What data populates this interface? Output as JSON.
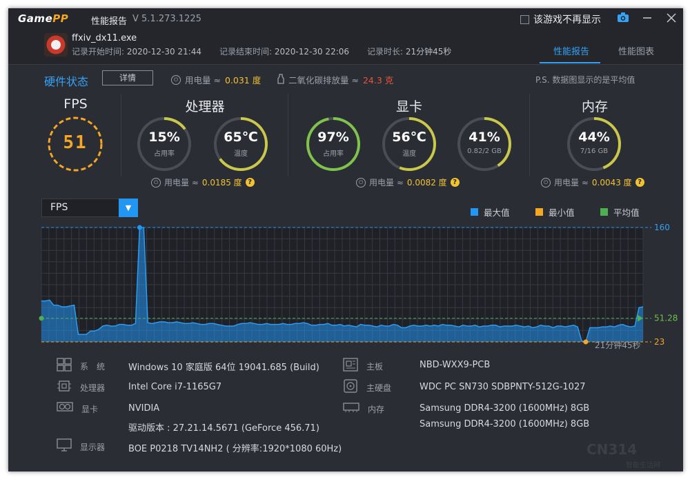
{
  "window": {
    "logo_game": "Game",
    "logo_pp": "PP",
    "title": "性能报告",
    "version": "V 5.1.273.1225",
    "no_show_label": "该游戏不再显示"
  },
  "icons": {
    "camera": "camera-icon",
    "minimize": "minimize-icon",
    "close": "close-icon",
    "power": "power-icon",
    "co2": "co2-icon",
    "question": "question-icon",
    "dropdown": "chevron-down-icon"
  },
  "game": {
    "exe": "ffxiv_dx11.exe",
    "start_label": "记录开始时间:",
    "start": "2020-12-30 21:44",
    "end_label": "记录结束时间:",
    "end": "2020-12-30 22:06",
    "duration_label": "记录时长:",
    "duration": "21分钟45秒"
  },
  "tabs": [
    {
      "label": "性能报告",
      "active": true
    },
    {
      "label": "性能图表",
      "active": false
    }
  ],
  "hardware": {
    "title": "硬件状态",
    "detail_button": "详情",
    "power_label": "用电量 ≈",
    "power_value": "0.031 度",
    "co2_label": "二氧化碳排放量 ≈",
    "co2_value": "24.3 克",
    "note": "P.S. 数据图显示的是平均值"
  },
  "fps": {
    "title": "FPS",
    "value": "51"
  },
  "cpu": {
    "title": "处理器",
    "usage": {
      "value": "15%",
      "label": "占用率",
      "level": 0.15
    },
    "temp": {
      "value": "65℃",
      "label": "温度",
      "level": 0.65
    },
    "power_label": "用电量 ≈",
    "power_value": "0.0185 度",
    "help": "?"
  },
  "gpu": {
    "title": "显卡",
    "usage": {
      "value": "97%",
      "label": "占用率",
      "level": 0.97
    },
    "temp": {
      "value": "56℃",
      "label": "温度",
      "level": 0.56
    },
    "mem": {
      "value": "41%",
      "label": "0.82/2 GB",
      "level": 0.41
    },
    "power_label": "用电量 ≈",
    "power_value": "0.0082 度",
    "help": "?"
  },
  "ram": {
    "title": "内存",
    "usage": {
      "value": "44%",
      "label": "7/16 GB",
      "level": 0.44
    },
    "power_label": "用电量 ≈",
    "power_value": "0.0043 度",
    "help": "?"
  },
  "selector": {
    "value": "FPS"
  },
  "legend": [
    {
      "label": "最大值",
      "color": "#2196f3"
    },
    {
      "label": "最小值",
      "color": "#f5a623"
    },
    {
      "label": "平均值",
      "color": "#4caf50"
    }
  ],
  "chart_data": {
    "type": "area",
    "title": "",
    "xlabel": "",
    "ylabel": "",
    "ylim": [
      23,
      160
    ],
    "max": 160,
    "min": 23,
    "avg": 51.28,
    "labels": {
      "max": "160",
      "avg": "51.28",
      "min": "23"
    },
    "x_end_label": "21分钟45秒",
    "series": [
      {
        "values": [
          72,
          72,
          73,
          67,
          67,
          65,
          65,
          66,
          67,
          32,
          32,
          32,
          36,
          36,
          38,
          42,
          43,
          42,
          42,
          44,
          44,
          43,
          43,
          45,
          160,
          160,
          46,
          45,
          46,
          47,
          47,
          46,
          46,
          47,
          46,
          45,
          45,
          46,
          45,
          44,
          44,
          45,
          45,
          44,
          43,
          42,
          42,
          42,
          44,
          45,
          45,
          46,
          45,
          44,
          44,
          45,
          44,
          44,
          44,
          45,
          44,
          44,
          45,
          45,
          46,
          45,
          43,
          43,
          44,
          44,
          45,
          43,
          43,
          44,
          42,
          43,
          42,
          41,
          44,
          43,
          43,
          42,
          41,
          43,
          42,
          42,
          44,
          43,
          40,
          40,
          42,
          43,
          42,
          42,
          43,
          42,
          43,
          42,
          44,
          43,
          43,
          42,
          41,
          43,
          42,
          42,
          43,
          41,
          42,
          42,
          43,
          43,
          41,
          42,
          42,
          42,
          43,
          42,
          41,
          42,
          40,
          41,
          43,
          42,
          42,
          40,
          42,
          42,
          41,
          42,
          43,
          41,
          24,
          23,
          40,
          40,
          40,
          41,
          41,
          42,
          41,
          43,
          44,
          42,
          41,
          42,
          64,
          65
        ]
      }
    ]
  },
  "system": {
    "os_label": "系　统",
    "os": "Windows 10 家庭版 64位   19041.685 (Build)",
    "cpu_label": "处理器",
    "cpu": "Intel Core i7-1165G7",
    "gpu_label": "显卡",
    "gpu": "NVIDIA",
    "driver": "驱动版本 : 27.21.14.5671 (GeForce 456.71)",
    "monitor_label": "显示器",
    "monitor": "BOE P0218 TV14NH2 ( 分辨率:1920*1080 60Hz)",
    "board_label": "主板",
    "board": "NBD-WXX9-PCB",
    "disk_label": "主硬盘",
    "disk": "WDC PC SN730 SDBPNTY-512G-1027",
    "ram_label": "内存",
    "ram1": "Samsung DDR4-3200 (1600MHz) 8GB",
    "ram2": "Samsung DDR4-3200 (1600MHz) 8GB"
  },
  "watermark": {
    "text": "CN314",
    "sub": "智能生活网"
  }
}
